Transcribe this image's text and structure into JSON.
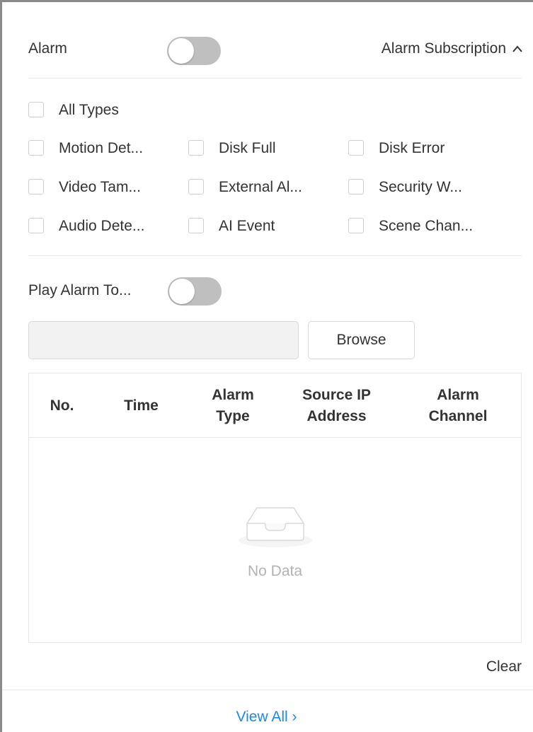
{
  "header": {
    "alarm_label": "Alarm",
    "alarm_toggle_on": false,
    "subscription_label": "Alarm Subscription"
  },
  "types": {
    "all_label": "All Types",
    "items": [
      {
        "label": "Motion Det...",
        "checked": false
      },
      {
        "label": "Disk Full",
        "checked": false
      },
      {
        "label": "Disk Error",
        "checked": false
      },
      {
        "label": "Video Tam...",
        "checked": false
      },
      {
        "label": "External Al...",
        "checked": false
      },
      {
        "label": "Security W...",
        "checked": false
      },
      {
        "label": "Audio Dete...",
        "checked": false
      },
      {
        "label": "AI Event",
        "checked": false
      },
      {
        "label": "Scene Chan...",
        "checked": false
      }
    ]
  },
  "play_tone": {
    "label": "Play Alarm To...",
    "toggle_on": false,
    "file_value": "",
    "browse_label": "Browse"
  },
  "table": {
    "columns": [
      {
        "line1": "No.",
        "line2": ""
      },
      {
        "line1": "Time",
        "line2": ""
      },
      {
        "line1": "Alarm",
        "line2": "Type"
      },
      {
        "line1": "Source IP",
        "line2": "Address"
      },
      {
        "line1": "Alarm",
        "line2": "Channel"
      }
    ],
    "rows": [],
    "empty_text": "No Data"
  },
  "actions": {
    "clear_label": "Clear",
    "view_all_label": "View All ›"
  },
  "colors": {
    "toggle_off": "#bfbfbf",
    "link": "#1e88e5",
    "divider": "#e8e8e8",
    "empty_text": "#b3b3b3"
  },
  "icons": [
    "chevron-up-icon",
    "empty-inbox-icon"
  ]
}
